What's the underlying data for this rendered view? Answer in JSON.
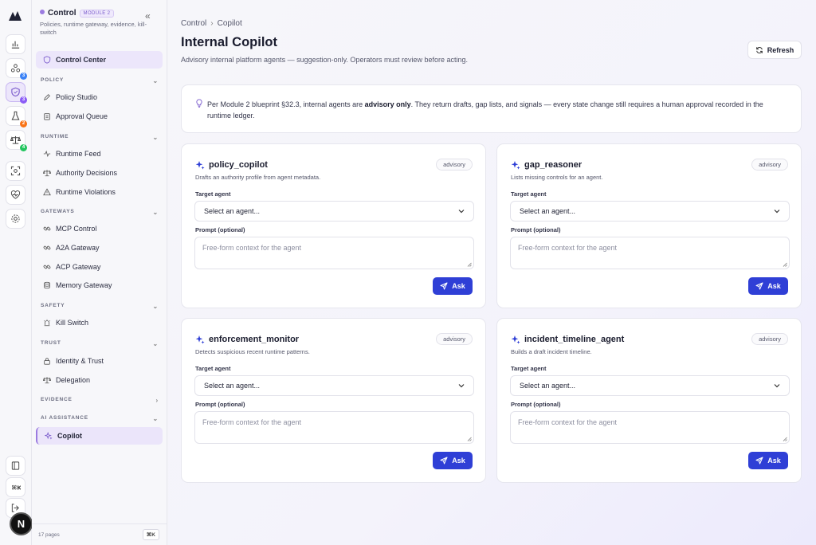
{
  "rail": {
    "badges": [
      "3",
      "3",
      "2",
      "4"
    ],
    "colors": {
      "badge_blue": "#3b82f6",
      "badge_purple": "#8b5cf6",
      "badge_orange": "#f97316",
      "badge_green": "#22c55e"
    },
    "avatar_initial": "N"
  },
  "sidebar": {
    "title": "Control",
    "module_badge": "MODULE 2",
    "description": "Policies, runtime gateway, evidence, kill-switch",
    "control_center": "Control Center",
    "sections": {
      "policy": "POLICY",
      "runtime": "RUNTIME",
      "gateways": "GATEWAYS",
      "safety": "SAFETY",
      "trust": "TRUST",
      "evidence": "EVIDENCE",
      "ai_assistance": "AI ASSISTANCE"
    },
    "items": {
      "policy_studio": "Policy Studio",
      "approval_queue": "Approval Queue",
      "runtime_feed": "Runtime Feed",
      "authority_decisions": "Authority Decisions",
      "runtime_violations": "Runtime Violations",
      "mcp_control": "MCP Control",
      "a2a_gateway": "A2A Gateway",
      "acp_gateway": "ACP Gateway",
      "memory_gateway": "Memory Gateway",
      "kill_switch": "Kill Switch",
      "identity_trust": "Identity & Trust",
      "delegation": "Delegation",
      "copilot": "Copilot"
    },
    "footer": {
      "pages": "17 pages",
      "shortcut": "⌘K"
    }
  },
  "main": {
    "breadcrumb": {
      "parent": "Control",
      "current": "Copilot"
    },
    "title": "Internal Copilot",
    "subtitle": "Advisory internal platform agents — suggestion-only. Operators must review before acting.",
    "refresh_label": "Refresh",
    "notice": {
      "before": "Per Module 2 blueprint §32.3, internal agents are ",
      "bold": "advisory only",
      "after": ". They return drafts, gap lists, and signals — every state change still requires a human approval recorded in the runtime ledger."
    },
    "agents": [
      {
        "name": "policy_copilot",
        "badge": "advisory",
        "description": "Drafts an authority profile from agent metadata.",
        "target_label": "Target agent",
        "select_value": "Select an agent...",
        "prompt_label": "Prompt (optional)",
        "prompt_placeholder": "Free-form context for the agent",
        "ask_label": "Ask"
      },
      {
        "name": "gap_reasoner",
        "badge": "advisory",
        "description": "Lists missing controls for an agent.",
        "target_label": "Target agent",
        "select_value": "Select an agent...",
        "prompt_label": "Prompt (optional)",
        "prompt_placeholder": "Free-form context for the agent",
        "ask_label": "Ask"
      },
      {
        "name": "enforcement_monitor",
        "badge": "advisory",
        "description": "Detects suspicious recent runtime patterns.",
        "target_label": "Target agent",
        "select_value": "Select an agent...",
        "prompt_label": "Prompt (optional)",
        "prompt_placeholder": "Free-form context for the agent",
        "ask_label": "Ask"
      },
      {
        "name": "incident_timeline_agent",
        "badge": "advisory",
        "description": "Builds a draft incident timeline.",
        "target_label": "Target agent",
        "select_value": "Select an agent...",
        "prompt_label": "Prompt (optional)",
        "prompt_placeholder": "Free-form context for the agent",
        "ask_label": "Ask"
      }
    ]
  },
  "colors": {
    "accent": "#2f3fd6",
    "active_bg": "#ebe5fa",
    "active_border": "#9b7be0"
  }
}
